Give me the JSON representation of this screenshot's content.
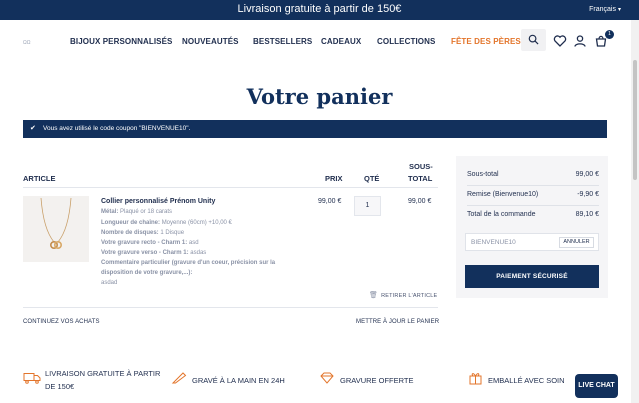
{
  "announcement": {
    "message": "Livraison gratuite à partir de 150€",
    "language": "Français"
  },
  "header": {
    "logo": "ΩΩ",
    "nav": [
      "BIJOUX PERSONNALISÉS",
      "NOUVEAUTÉS",
      "BESTSELLERS",
      "CADEAUX",
      "COLLECTIONS",
      "FÊTE DES PÈRES"
    ],
    "cart_count": "1"
  },
  "page_title": "Votre panier",
  "coupon_notice": "Vous avez utilisé le code coupon \"BIENVENUE10\".",
  "table_headers": {
    "article": "ARTICLE",
    "price": "PRIX",
    "qty": "QTÉ",
    "subtotal_1": "SOUS-",
    "subtotal_2": "TOTAL"
  },
  "item": {
    "name": "Collier personnalisé Prénom Unity",
    "properties": [
      {
        "label": "Métal:",
        "value": "Plaqué or 18 carats"
      },
      {
        "label": "Longueur de chaîne:",
        "value": "Moyenne (60cm) +10,00 €"
      },
      {
        "label": "Nombre de disques:",
        "value": "1 Disque"
      },
      {
        "label": "Votre gravure recto - Charm 1:",
        "value": "asd"
      },
      {
        "label": "Votre gravure verso - Charm 1:",
        "value": "asdas"
      },
      {
        "label": "Commentaire particulier (gravure d'un coeur, précision sur la",
        "value": ""
      },
      {
        "label": "disposition de votre gravure,...):",
        "value": ""
      },
      {
        "label": "",
        "value": "asdad"
      }
    ],
    "price": "99,00 €",
    "quantity": "1",
    "subtotal": "99,00 €",
    "remove_label": "RETIRER L'ARTICLE"
  },
  "links": {
    "continue": "CONTINUEZ VOS ACHATS",
    "update": "METTRE À JOUR LE PANIER"
  },
  "summary": {
    "subtotal_label": "Sous-total",
    "subtotal_value": "99,00 €",
    "discount_label": "Remise (Bienvenue10)",
    "discount_value": "-9,90 €",
    "total_label": "Total de la commande",
    "total_value": "89,10 €",
    "coupon_placeholder": "BIENVENUE10",
    "apply_label": "ANNULER",
    "pay_label": "PAIEMENT SÉCURISÉ"
  },
  "features": [
    {
      "line1": "LIVRAISON GRATUITE À PARTIR",
      "line2": "DE 150€"
    },
    {
      "line1": "GRAVÉ À LA MAIN EN 24H",
      "line2": ""
    },
    {
      "line1": "GRAVURE OFFERTE",
      "line2": ""
    },
    {
      "line1": "EMBALLÉ AVEC SOIN",
      "line2": ""
    }
  ],
  "livechat": "LIVE CHAT",
  "colors": {
    "navy": "#12305c",
    "accent": "#e3752b"
  }
}
